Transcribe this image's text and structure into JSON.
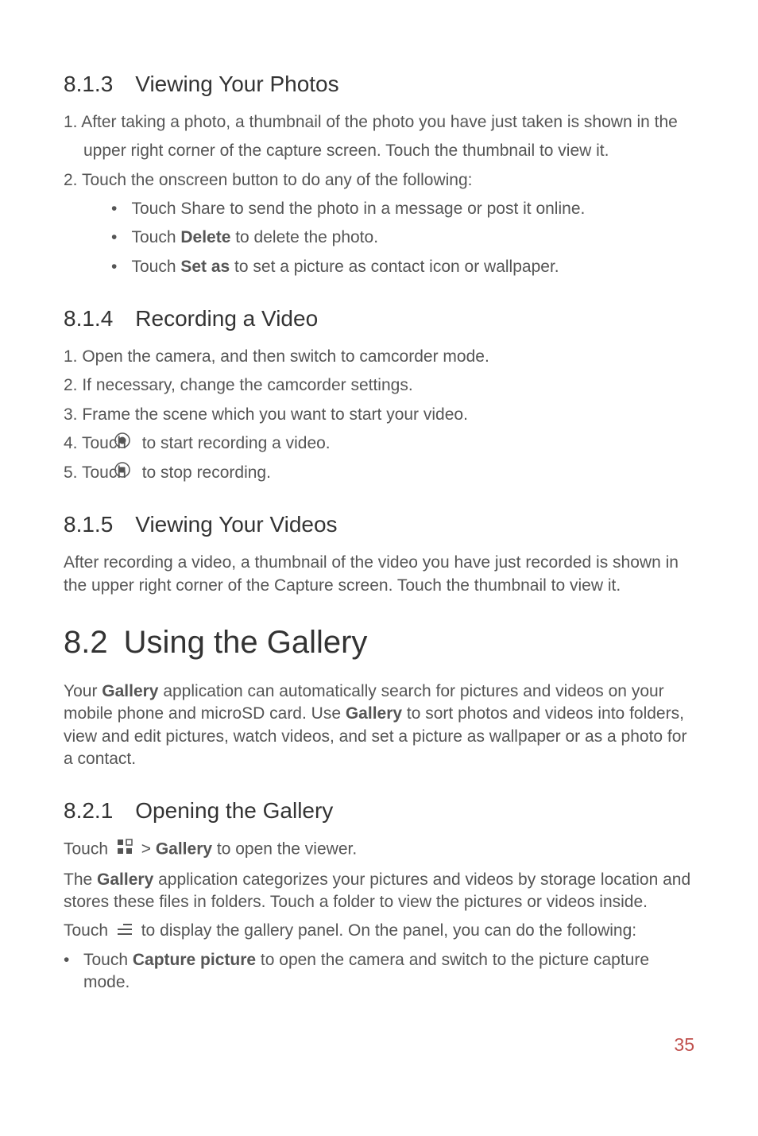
{
  "s813": {
    "heading": "8.1.3 Viewing Your Photos",
    "item1a": "1. After taking a photo, a thumbnail of the photo you have just taken is shown in the",
    "item1b": "upper right corner of the capture screen. Touch the thumbnail to view it.",
    "item2": "2. Touch the onscreen button to do any of the following:",
    "bullet1": "Touch Share to send the photo in a message or post it online.",
    "bullet2a": "Touch ",
    "bullet2b": "Delete",
    "bullet2c": " to delete the photo.",
    "bullet3a": "Touch ",
    "bullet3b": "Set as",
    "bullet3c": " to set a picture as contact icon or wallpaper."
  },
  "s814": {
    "heading": "8.1.4 Recording a Video",
    "item1": "1. Open the camera, and then switch to camcorder mode.",
    "item2": "2. If necessary, change the camcorder settings.",
    "item3": "3. Frame the scene which you want to start your video.",
    "item4a": "4. Touch ",
    "item4b": " to start recording a video.",
    "item5a": "5. Touch ",
    "item5b": " to stop recording."
  },
  "s815": {
    "heading": "8.1.5 Viewing Your Videos",
    "para": "After recording a video, a thumbnail of the video you have just recorded is shown in the upper right corner of the Capture screen. Touch the thumbnail to view it."
  },
  "s82": {
    "heading": "8.2 Using the Gallery",
    "para_a": "Your ",
    "para_b": "Gallery",
    "para_c": " application can automatically search for pictures and videos on your mobile phone and microSD card. Use ",
    "para_d": "Gallery",
    "para_e": " to sort photos and videos into folders, view and edit pictures, watch videos, and set a picture as wallpaper or as a photo for a contact."
  },
  "s821": {
    "heading": "8.2.1 Opening the Gallery",
    "line1a": "Touch ",
    "line1b": " > ",
    "line1c": "Gallery",
    "line1d": " to open the viewer.",
    "line2a": "The ",
    "line2b": "Gallery",
    "line2c": " application categorizes your pictures and videos by storage location and stores these files in folders. Touch a folder to view the pictures or videos inside.",
    "line3a": "Touch ",
    "line3b": " to display the gallery panel. On the panel, you can do the following:",
    "bullet1a": "Touch ",
    "bullet1b": "Capture picture",
    "bullet1c": " to open the camera and switch to the picture capture mode."
  },
  "page_number": "35"
}
